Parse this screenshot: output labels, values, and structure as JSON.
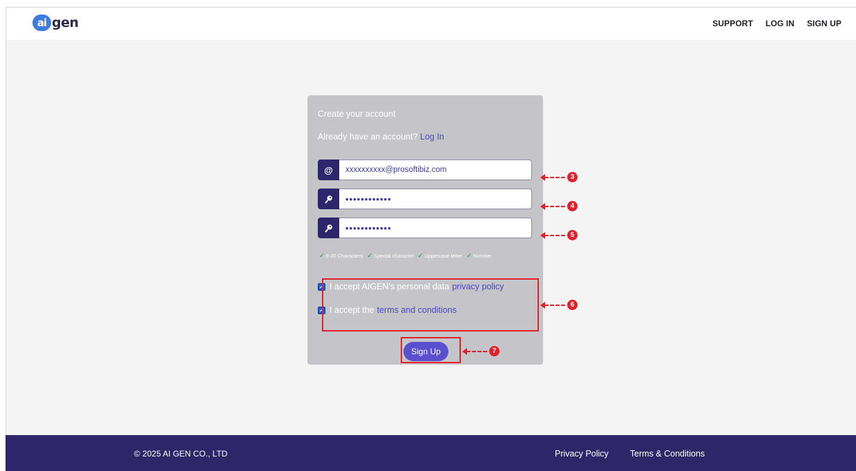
{
  "header": {
    "logo_mark": "ai",
    "logo_text": "gen",
    "nav": [
      "SUPPORT",
      "LOG IN",
      "SIGN UP"
    ]
  },
  "form": {
    "title": "Create your account",
    "already_text": "Already have an account?",
    "login_link": "Log In",
    "email_value": "xxxxxxxxxx@prosoftibiz.com",
    "password_value": "••••••••••••",
    "confirm_password_value": "••••••••••••",
    "email_icon": "@",
    "rules": [
      "8-20 Characters",
      "Special character",
      "Uppercase letter",
      "Number"
    ],
    "privacy_text": "I accept AIGEN's personal data",
    "privacy_link": "privacy policy",
    "terms_text": "I accept the",
    "terms_link": "terms and conditions",
    "submit_label": "Sign Up"
  },
  "annotations": [
    "3",
    "4",
    "5",
    "6",
    "7"
  ],
  "footer": {
    "copyright": "© 2025 AI GEN CO., LTD",
    "links": [
      "Privacy Policy",
      "Terms & Conditions"
    ]
  },
  "colors": {
    "brand_dark": "#2f2569",
    "accent": "#5a4fcf",
    "link": "#4c46c6",
    "annotation": "#e0202a",
    "check_green": "#1f9a32"
  }
}
